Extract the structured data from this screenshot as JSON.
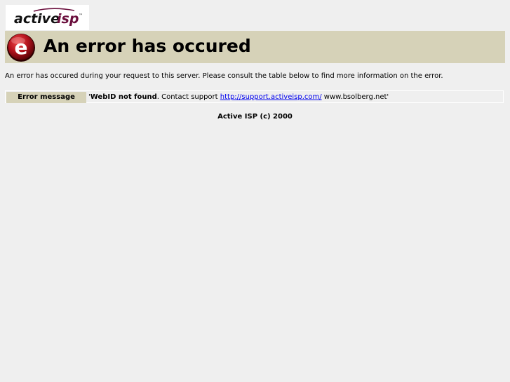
{
  "logo": {
    "word_active": "active",
    "word_isp": "isp",
    "trademark": "™"
  },
  "header": {
    "badge_letter": "e",
    "title": "An error has occured"
  },
  "intro": "An error has occured during your request to this server. Please consult the table below to find more information on the error.",
  "error_table": {
    "label": "Error message",
    "quote_open": "'",
    "bold_text": "WebID not found",
    "text_before_link": ". Contact support ",
    "link_text": "http://support.activeisp.com/",
    "text_after_link": " www.bsolberg.net'"
  },
  "footer": "Active ISP (c) 2000",
  "colors": {
    "page_background": "#efefef",
    "band": "#d6d2b8",
    "brand_isp": "#6b0f3d",
    "badge_red": "#b3121c",
    "link": "#0000ee"
  }
}
